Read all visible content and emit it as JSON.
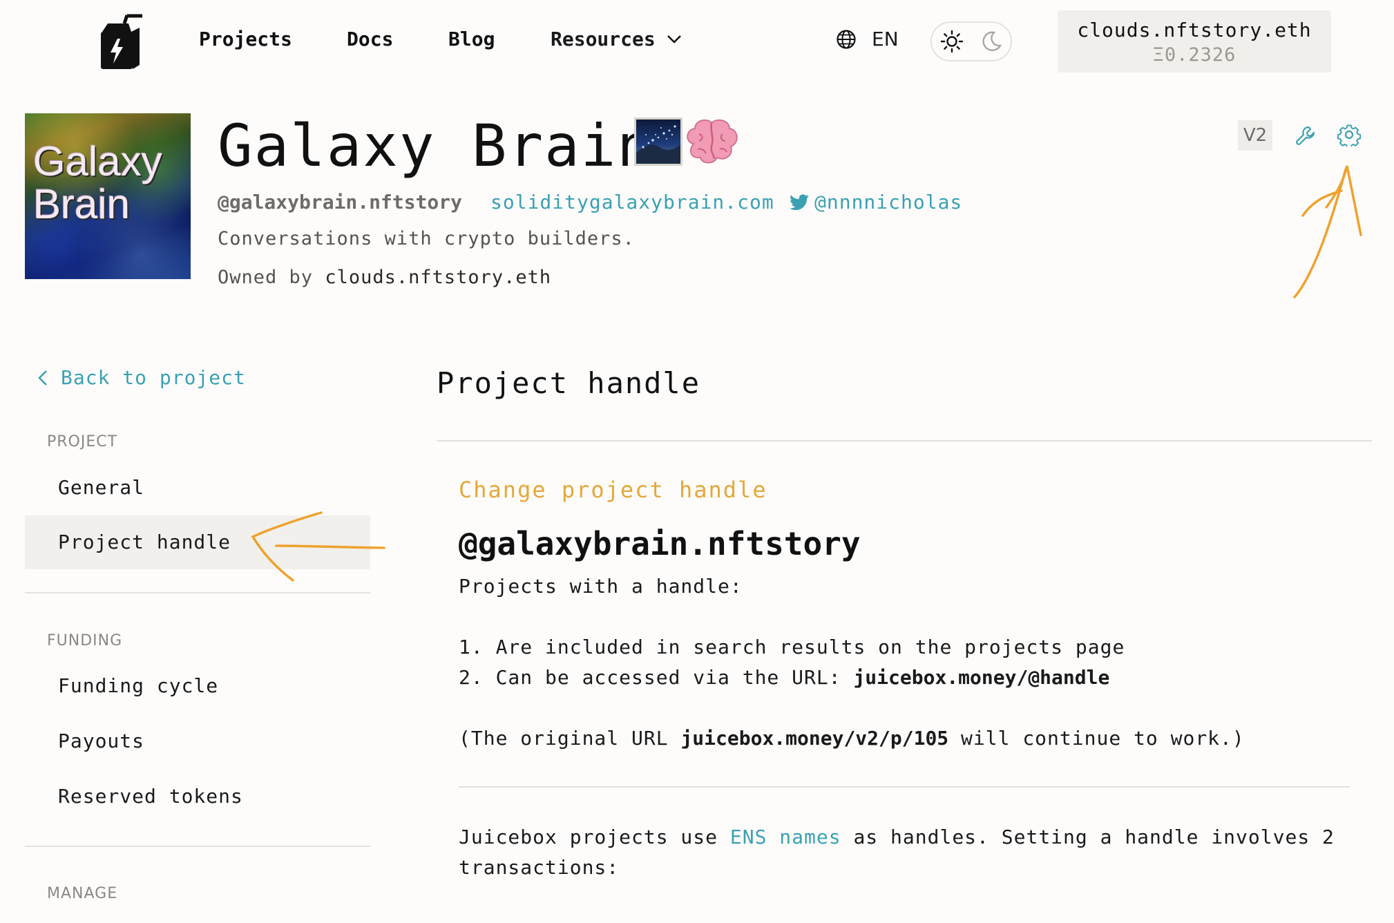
{
  "header": {
    "nav": [
      "Projects",
      "Docs",
      "Blog",
      "Resources"
    ],
    "language": "EN",
    "wallet": {
      "address": "clouds.nftstory.eth",
      "balance": "Ξ0.2326"
    }
  },
  "project": {
    "logo_text": [
      "Galaxy",
      "Brain"
    ],
    "title": "Galaxy Brain",
    "handle": "@galaxybrain.nftstory",
    "website": "soliditygalaxybrain.com",
    "twitter": "@nnnnicholas",
    "description": "Conversations with crypto builders.",
    "owned_by_label": "Owned by",
    "owner": "clouds.nftstory.eth",
    "version_badge": "V2"
  },
  "sidebar": {
    "back_label": "Back to project",
    "sections": [
      {
        "label": "PROJECT",
        "items": [
          "General",
          "Project handle"
        ]
      },
      {
        "label": "FUNDING",
        "items": [
          "Funding cycle",
          "Payouts",
          "Reserved tokens"
        ]
      },
      {
        "label": "MANAGE",
        "items": []
      }
    ],
    "active_item": "Project handle"
  },
  "main": {
    "title": "Project handle",
    "change_label": "Change project handle",
    "current_handle": "@galaxybrain.nftstory",
    "intro": "Projects with a handle:",
    "point1": "1. Are included in search results on the projects page",
    "point2_prefix": "2. Can be accessed via the URL:",
    "point2_url": "juicebox.money/@handle",
    "note_prefix": "(The original URL",
    "note_url": "juicebox.money/v2/p/105",
    "note_suffix": "will continue to work.)",
    "ens_prefix": "Juicebox projects use",
    "ens_link": "ENS names",
    "ens_suffix": "as handles. Setting a handle involves 2",
    "ens_line2": "transactions:"
  },
  "colors": {
    "accent": "#3aa1b3",
    "highlight": "#e5a73a",
    "annotation": "#f0a12e",
    "background": "#fdfcfb"
  }
}
